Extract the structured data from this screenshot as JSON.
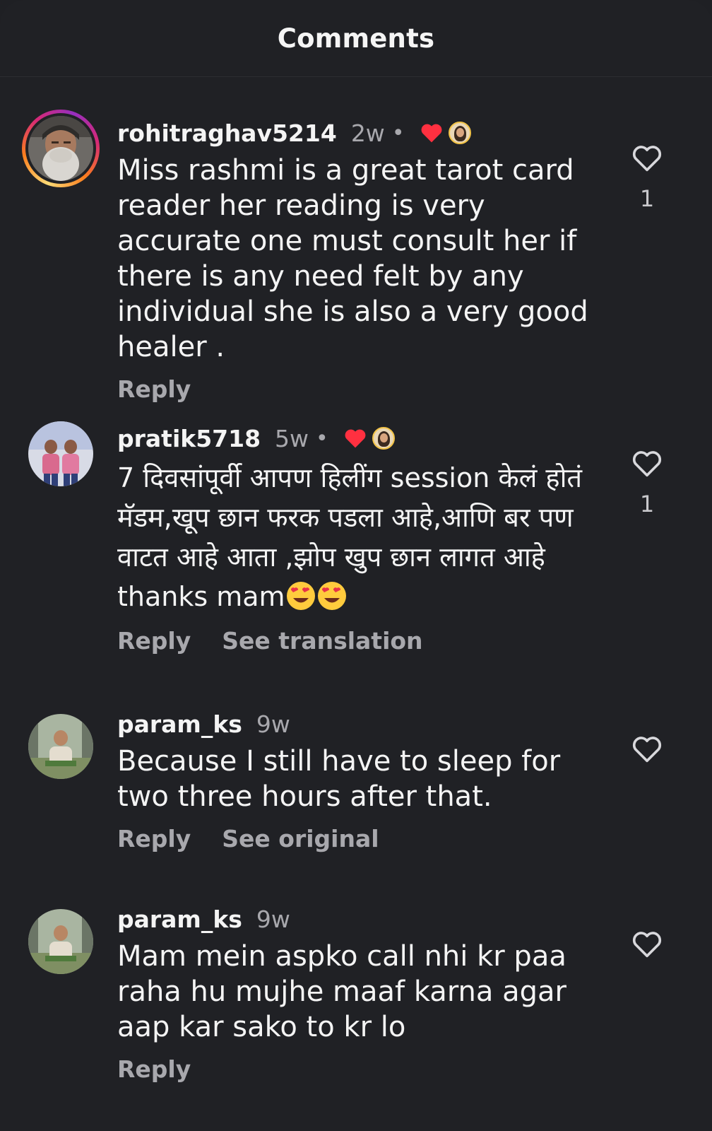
{
  "header": {
    "title": "Comments"
  },
  "colors": {
    "background": "#202125",
    "text": "#f4f4f4",
    "muted": "#a8a8ad",
    "heart": "#ff3040",
    "story_ring": [
      "#feda75",
      "#fa7e1e",
      "#d62976",
      "#962fbf"
    ]
  },
  "comments": [
    {
      "username": "rohitraghav5214",
      "time": "2w",
      "dot": "•",
      "liked_by_creator": true,
      "story_ring": true,
      "text": "Miss rashmi is a great tarot card reader her reading is very accurate one must consult her if there is any need felt by any individual she is also a very good healer .",
      "actions": [
        "Reply"
      ],
      "like_count": "1"
    },
    {
      "username": "pratik5718",
      "time": "5w",
      "dot": "•",
      "liked_by_creator": true,
      "story_ring": false,
      "text": "7 दिवसांपूर्वी आपण हिलींग session केलं होतं मॅडम,खूप छान फरक पडला आहे,आणि बर पण वाटत आहे आता ,झोप खुप छान लागत आहे thanks mam",
      "emojis": [
        "smiling-face-with-heart-eyes",
        "smiling-face-with-heart-eyes"
      ],
      "actions": [
        "Reply",
        "See translation"
      ],
      "like_count": "1"
    },
    {
      "username": "param_ks",
      "time": "9w",
      "liked_by_creator": false,
      "story_ring": false,
      "text": "Because I still have to sleep for two three hours after that.",
      "actions": [
        "Reply",
        "See original"
      ],
      "like_count": ""
    },
    {
      "username": "param_ks",
      "time": "9w",
      "liked_by_creator": false,
      "story_ring": false,
      "text": "Mam mein aspko call nhi kr paa raha hu mujhe maaf karna agar aap kar sako to kr lo",
      "actions": [
        "Reply"
      ],
      "like_count": ""
    }
  ]
}
